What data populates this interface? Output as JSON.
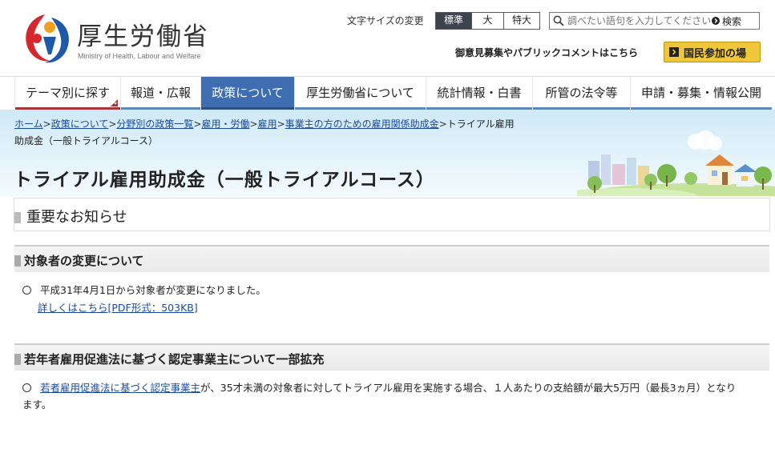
{
  "header": {
    "logo_title": "厚生労働省",
    "logo_subtitle": "Ministry of Health, Labour and Welfare",
    "fontsize_label": "文字サイズの変更",
    "fontsize_options": [
      "標準",
      "大",
      "特大"
    ],
    "fontsize_selected": "標準",
    "search_placeholder": "調べたい語句を入力してください",
    "search_button": "検索",
    "pubcomment_text": "御意見募集やパブリックコメントはこちら",
    "kokumin_button": "国民参加の場"
  },
  "nav": {
    "items": [
      "テーマ別に探す",
      "報道・広報",
      "政策について",
      "厚生労働省について",
      "統計情報・白書",
      "所管の法令等",
      "申請・募集・情報公開"
    ],
    "active": "政策について"
  },
  "breadcrumb": {
    "items": [
      "ホーム",
      "政策について",
      "分野別の政策一覧",
      "雇用・労働",
      "雇用",
      "事業主の方のための雇用関係助成金"
    ],
    "current_line1": "トライアル雇用",
    "current_line2": "助成金（一般トライアルコース）",
    "separator": ">"
  },
  "page": {
    "title": "トライアル雇用助成金（一般トライアルコース）",
    "notice_title": "重要なお知らせ",
    "section1": {
      "title": "対象者の変更について",
      "bullet_text": "平成31年4月1日から対象者が変更になりました。",
      "link_text": "詳しくはこちら[PDF形式：503KB]"
    },
    "section2": {
      "title": "若年者雇用促進法に基づく認定事業主について一部拡充",
      "link_text": "若者雇用促進法に基づく認定事業主",
      "text_after_link": "が、35才未満の対象者に対してトライアル雇用を実施する場合、１人あたりの支給額が最大5万円（最長3ヵ月）となり",
      "text_line2": "ます。"
    }
  },
  "colors": {
    "nav_active": "#3f6db1",
    "nav_bar": "#5b88b8",
    "theme_bar": "#a5373b",
    "link": "#1a4aa0",
    "kokumin_bg": "#f1c73a",
    "logo_red": "#d7262c",
    "logo_blue": "#1d59a8"
  }
}
